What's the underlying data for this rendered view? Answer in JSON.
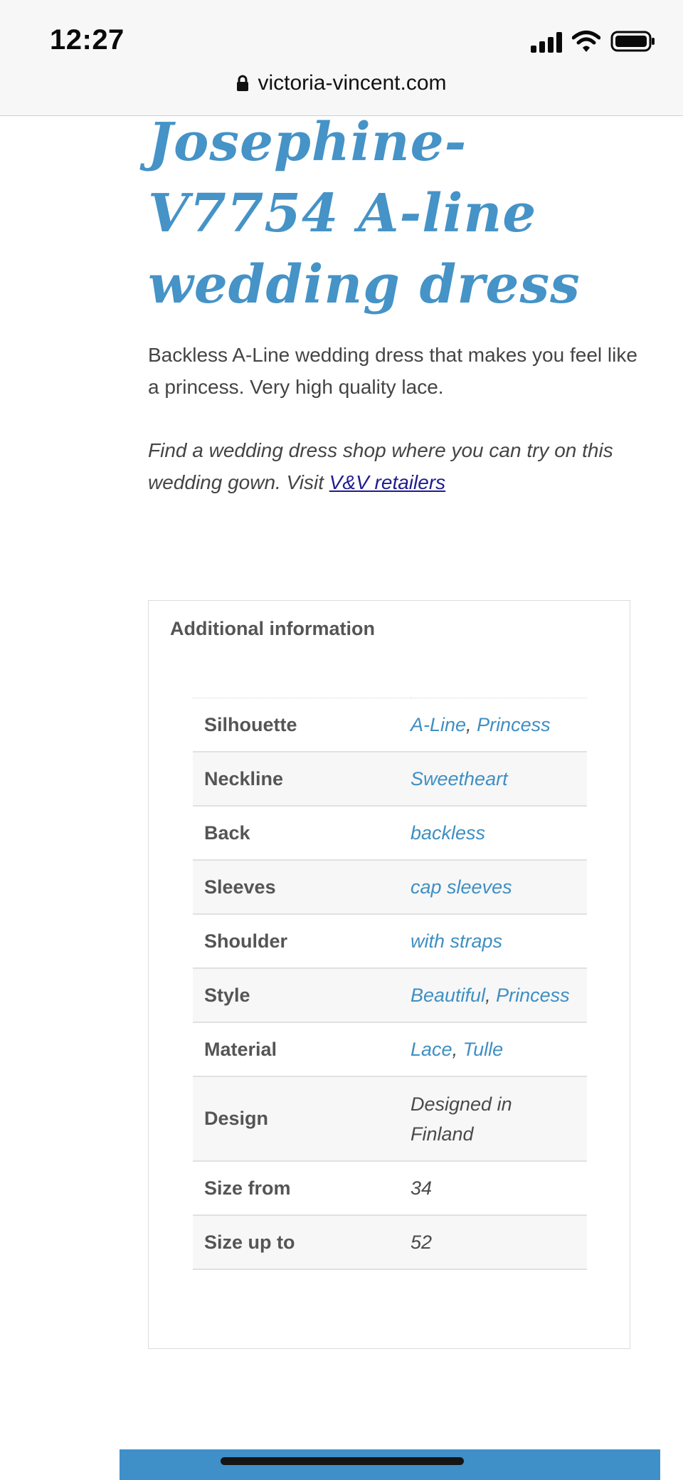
{
  "status_bar": {
    "time": "12:27",
    "icons": [
      "signal-icon",
      "wifi-icon",
      "battery-icon"
    ]
  },
  "browser": {
    "url": "victoria-vincent.com",
    "lock_icon": "lock-icon"
  },
  "product": {
    "title": "Josephine-V7754 A-line wedding dress",
    "description": "Backless A-Line wedding dress that makes you feel like a princess. Very high quality lace.",
    "find_text": "Find a wedding dress shop where you can try on this wedding gown. Visit ",
    "retailers_link": "V&V retailers"
  },
  "additional_info": {
    "title": "Additional information",
    "rows": [
      {
        "label": "Silhouette",
        "values": [
          "A-Line",
          "Princess"
        ],
        "linked": true
      },
      {
        "label": "Neckline",
        "values": [
          "Sweetheart"
        ],
        "linked": true
      },
      {
        "label": "Back",
        "values": [
          "backless"
        ],
        "linked": true
      },
      {
        "label": "Sleeves",
        "values": [
          "cap sleeves"
        ],
        "linked": true
      },
      {
        "label": "Shoulder",
        "values": [
          "with straps"
        ],
        "linked": true
      },
      {
        "label": "Style",
        "values": [
          "Beautiful",
          "Princess"
        ],
        "linked": true
      },
      {
        "label": "Material",
        "values": [
          "Lace",
          "Tulle"
        ],
        "linked": true
      },
      {
        "label": "Design",
        "values": [
          "Designed in Finland"
        ],
        "linked": false
      },
      {
        "label": "Size from",
        "values": [
          "34"
        ],
        "linked": false
      },
      {
        "label": "Size up to",
        "values": [
          "52"
        ],
        "linked": false
      }
    ]
  },
  "colors": {
    "accent": "#4593c7",
    "link_text": "#3f8fc3",
    "retailer_link": "#1f1c8f",
    "footer": "#3f8fc9"
  }
}
